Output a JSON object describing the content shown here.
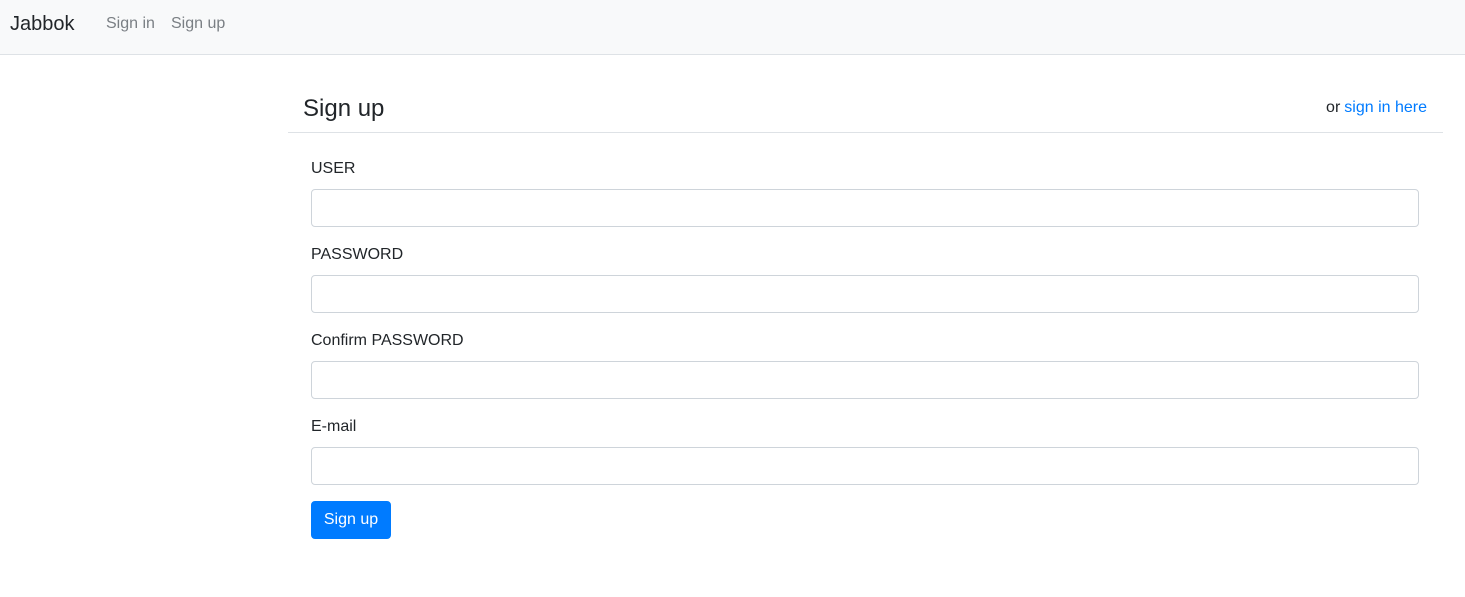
{
  "navbar": {
    "brand": "Jabbok",
    "links": [
      {
        "label": "Sign in"
      },
      {
        "label": "Sign up"
      }
    ]
  },
  "header": {
    "title": "Sign up",
    "alt_prefix": "or",
    "alt_link": "sign in here"
  },
  "form": {
    "fields": [
      {
        "label": "USER",
        "value": "",
        "placeholder": ""
      },
      {
        "label": "PASSWORD",
        "value": "",
        "placeholder": ""
      },
      {
        "label": "Confirm PASSWORD",
        "value": "",
        "placeholder": ""
      },
      {
        "label": "E-mail",
        "value": "",
        "placeholder": ""
      }
    ],
    "submit_label": "Sign up"
  },
  "colors": {
    "navbar_bg": "#f8f9fa",
    "primary": "#007bff",
    "link": "#007bff",
    "nav_link": "#7a7f84",
    "text": "#212529",
    "input_border": "#ced4da"
  }
}
